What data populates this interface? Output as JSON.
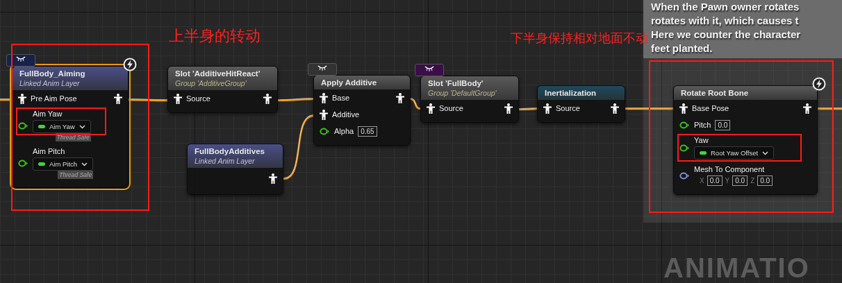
{
  "annotations": [
    {
      "text": "上半身的转动"
    },
    {
      "text": "下半身保持相对地面不动"
    }
  ],
  "comment": {
    "lines": [
      "When the Pawn owner rotates",
      "rotates with it, which causes t",
      "Here we counter the character",
      "feet planted."
    ]
  },
  "nodes": [
    {
      "kind": "linked_layer",
      "title": "FullBody_Aiming",
      "subtitle": "Linked Anim Layer",
      "color": "#4a4f86",
      "selected": true,
      "badge": {
        "color": "#17214a"
      },
      "fast_path": true,
      "pins": [
        {
          "kind": "pose",
          "label": "Pre Aim Pose",
          "output": true
        },
        {
          "kind": "variable",
          "label": "Aim Yaw",
          "variable": "Aim Yaw",
          "tag": "Thread Safe"
        },
        {
          "kind": "variable",
          "label": "Aim Pitch",
          "variable": "Aim Pitch",
          "tag": "Thread Safe"
        }
      ]
    },
    {
      "kind": "slot",
      "title": "Slot 'AdditiveHitReact'",
      "subtitle": "Group 'AdditiveGroup'",
      "color": "#5a5a5a",
      "selected": false,
      "pins": [
        {
          "kind": "pose",
          "label": "Source",
          "output": true
        }
      ]
    },
    {
      "kind": "linked_layer",
      "title": "FullBodyAdditives",
      "subtitle": "Linked Anim Layer",
      "color": "#4a4f86",
      "selected": false,
      "pins": [
        {
          "kind": "output"
        }
      ]
    },
    {
      "kind": "plain",
      "title": "Apply Additive",
      "color": "#5a5a5a",
      "selected": false,
      "badge": {
        "color": "#333333"
      },
      "pins": [
        {
          "kind": "pose",
          "label": "Base",
          "output": true
        },
        {
          "kind": "pose",
          "label": "Additive",
          "output": false
        },
        {
          "kind": "value",
          "label": "Alpha",
          "value": "0.65"
        }
      ]
    },
    {
      "kind": "slot",
      "title": "Slot 'FullBody'",
      "subtitle": "Group 'DefaultGroup'",
      "color": "#5a5a5a",
      "selected": false,
      "badge": {
        "color": "#3a0f48"
      },
      "pins": [
        {
          "kind": "pose",
          "label": "Source",
          "output": true
        }
      ]
    },
    {
      "kind": "plain",
      "title": "Inertialization",
      "color": "#1d4a5e",
      "selected": false,
      "pins": [
        {
          "kind": "pose",
          "label": "Source",
          "output": true
        }
      ]
    },
    {
      "kind": "plain",
      "title": "Rotate Root Bone",
      "color": "#5a5a5a",
      "selected": false,
      "fast_path": true,
      "pins": [
        {
          "kind": "pose",
          "label": "Base Pose",
          "output": true
        },
        {
          "kind": "value",
          "label": "Pitch",
          "value": "0.0"
        },
        {
          "kind": "variable",
          "label": "Yaw",
          "variable": "Root Yaw Offset"
        },
        {
          "kind": "vector",
          "label": "Mesh To Component",
          "components": [
            {
              "axis": "X",
              "value": "0.0"
            },
            {
              "axis": "Y",
              "value": "0.0"
            },
            {
              "axis": "Z",
              "value": "0.0"
            }
          ]
        }
      ]
    }
  ],
  "graph_label": "ANIMATIO"
}
